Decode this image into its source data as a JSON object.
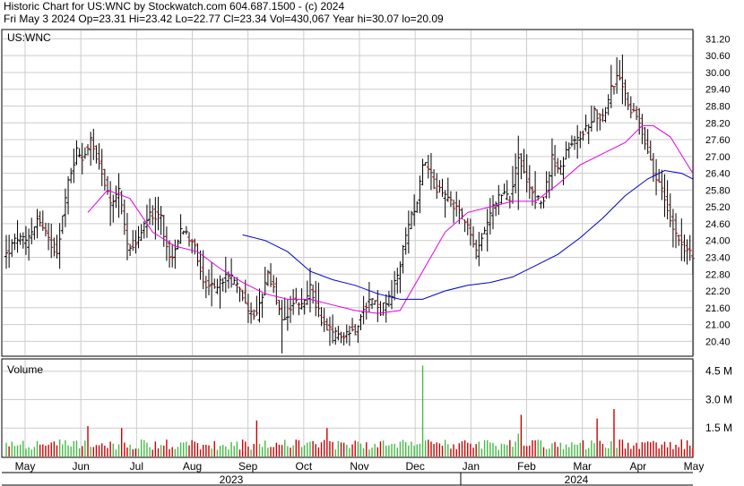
{
  "header": {
    "line1": "Historic Chart for US:WNC by Stockwatch.com 604.687.1500 - (c) 2024",
    "line2": "Fri May  3 2024   Op=23.31   Hi=23.42   Lo=22.77   Cl=23.34   Vol=430,067   Year hi=30.07   lo=20.09"
  },
  "colors": {
    "up": "#000000",
    "down": "#cc0000",
    "ma_short": "#e000e0",
    "ma_long": "#0000cc",
    "vol_up": "#44bb44",
    "vol_down": "#cc0000",
    "grid": "#cccccc"
  },
  "chart_data": [
    {
      "type": "ohlc",
      "symbol_label": "US:WNC",
      "x_months": [
        "May",
        "Jun",
        "Jul",
        "Aug",
        "Sep",
        "Oct",
        "Nov",
        "Dec",
        "Jan",
        "Feb",
        "Mar",
        "Apr",
        "May"
      ],
      "x_years": [
        "2023",
        "2024"
      ],
      "y_ticks": [
        "31.20",
        "30.60",
        "30.00",
        "29.40",
        "28.80",
        "28.20",
        "27.60",
        "27.00",
        "26.40",
        "25.80",
        "25.20",
        "24.60",
        "24.00",
        "23.40",
        "22.80",
        "22.20",
        "21.60",
        "21.00",
        "20.40"
      ],
      "ylim": [
        19.9,
        31.5
      ],
      "grid": true,
      "latest": {
        "date": "2024-05-03",
        "open": 23.31,
        "high": 23.42,
        "low": 22.77,
        "close": 23.34
      },
      "year_high": 30.07,
      "year_low": 20.09,
      "price_path": [
        [
          0,
          23.5
        ],
        [
          4,
          24.1
        ],
        [
          7,
          23.9
        ],
        [
          11,
          24.8
        ],
        [
          15,
          24.0
        ],
        [
          18,
          23.6
        ],
        [
          22,
          26.1
        ],
        [
          25,
          27.2
        ],
        [
          27,
          27.0
        ],
        [
          30,
          27.5
        ],
        [
          33,
          26.8
        ],
        [
          37,
          25.2
        ],
        [
          40,
          25.8
        ],
        [
          43,
          23.8
        ],
        [
          47,
          24.0
        ],
        [
          51,
          25.0
        ],
        [
          55,
          24.8
        ],
        [
          58,
          23.3
        ],
        [
          62,
          24.3
        ],
        [
          66,
          24.1
        ],
        [
          70,
          22.5
        ],
        [
          74,
          22.3
        ],
        [
          78,
          22.7
        ],
        [
          82,
          22.5
        ],
        [
          84,
          22.0
        ],
        [
          86,
          21.5
        ],
        [
          89,
          21.3
        ],
        [
          93,
          22.7
        ],
        [
          95,
          22.3
        ],
        [
          98,
          21.0
        ],
        [
          102,
          21.8
        ],
        [
          105,
          21.6
        ],
        [
          108,
          22.3
        ],
        [
          112,
          21.2
        ],
        [
          116,
          20.6
        ],
        [
          120,
          20.7
        ],
        [
          124,
          20.8
        ],
        [
          127,
          21.7
        ],
        [
          130,
          21.9
        ],
        [
          133,
          21.5
        ],
        [
          137,
          22.0
        ],
        [
          140,
          23.2
        ],
        [
          143,
          24.5
        ],
        [
          146,
          25.5
        ],
        [
          148,
          26.8
        ],
        [
          150,
          26.5
        ],
        [
          153,
          25.8
        ],
        [
          156,
          25.6
        ],
        [
          159,
          25.3
        ],
        [
          162,
          24.9
        ],
        [
          165,
          24.2
        ],
        [
          167,
          23.5
        ],
        [
          170,
          24.4
        ],
        [
          173,
          25.3
        ],
        [
          176,
          25.6
        ],
        [
          179,
          25.5
        ],
        [
          182,
          27.0
        ],
        [
          185,
          26.2
        ],
        [
          188,
          25.5
        ],
        [
          191,
          25.4
        ],
        [
          194,
          27.0
        ],
        [
          197,
          26.5
        ],
        [
          200,
          27.4
        ],
        [
          203,
          27.6
        ],
        [
          206,
          28.0
        ],
        [
          209,
          28.6
        ],
        [
          212,
          28.4
        ],
        [
          215,
          29.4
        ],
        [
          218,
          29.9
        ],
        [
          221,
          28.8
        ],
        [
          224,
          28.5
        ],
        [
          227,
          27.6
        ],
        [
          230,
          26.4
        ],
        [
          233,
          25.8
        ],
        [
          236,
          24.8
        ],
        [
          239,
          24.1
        ],
        [
          242,
          23.6
        ],
        [
          244,
          23.34
        ]
      ],
      "ma_short": [
        [
          29,
          25.0
        ],
        [
          36,
          25.8
        ],
        [
          44,
          25.5
        ],
        [
          52,
          24.3
        ],
        [
          60,
          23.8
        ],
        [
          68,
          23.6
        ],
        [
          76,
          23.0
        ],
        [
          84,
          22.5
        ],
        [
          92,
          22.1
        ],
        [
          100,
          21.9
        ],
        [
          108,
          21.9
        ],
        [
          116,
          21.7
        ],
        [
          124,
          21.5
        ],
        [
          132,
          21.4
        ],
        [
          140,
          21.5
        ],
        [
          148,
          22.9
        ],
        [
          156,
          24.3
        ],
        [
          164,
          25.0
        ],
        [
          172,
          25.2
        ],
        [
          180,
          25.4
        ],
        [
          188,
          25.4
        ],
        [
          196,
          26.0
        ],
        [
          204,
          26.7
        ],
        [
          212,
          27.1
        ],
        [
          220,
          27.5
        ],
        [
          226,
          28.1
        ],
        [
          230,
          28.1
        ],
        [
          236,
          27.7
        ],
        [
          244,
          26.4
        ]
      ],
      "ma_long": [
        [
          84,
          24.2
        ],
        [
          92,
          24.0
        ],
        [
          100,
          23.6
        ],
        [
          108,
          22.9
        ],
        [
          116,
          22.6
        ],
        [
          124,
          22.4
        ],
        [
          132,
          22.1
        ],
        [
          140,
          21.9
        ],
        [
          148,
          21.9
        ],
        [
          156,
          22.2
        ],
        [
          164,
          22.4
        ],
        [
          172,
          22.5
        ],
        [
          180,
          22.7
        ],
        [
          188,
          23.1
        ],
        [
          196,
          23.5
        ],
        [
          204,
          24.1
        ],
        [
          212,
          24.8
        ],
        [
          220,
          25.6
        ],
        [
          228,
          26.2
        ],
        [
          234,
          26.5
        ],
        [
          240,
          26.4
        ],
        [
          244,
          26.2
        ]
      ]
    },
    {
      "type": "bar",
      "title": "Volume",
      "y_ticks": [
        "4.5 M",
        "3.0 M",
        "1.5 M"
      ],
      "ylim": [
        0,
        5.1
      ],
      "spikes": [
        [
          29,
          1.6
        ],
        [
          41,
          1.5
        ],
        [
          89,
          1.9
        ],
        [
          114,
          1.5
        ],
        [
          148,
          4.8
        ],
        [
          182,
          1.2
        ],
        [
          183,
          2.2
        ],
        [
          210,
          2.0
        ],
        [
          216,
          2.5
        ],
        [
          240,
          0.9
        ]
      ]
    }
  ]
}
